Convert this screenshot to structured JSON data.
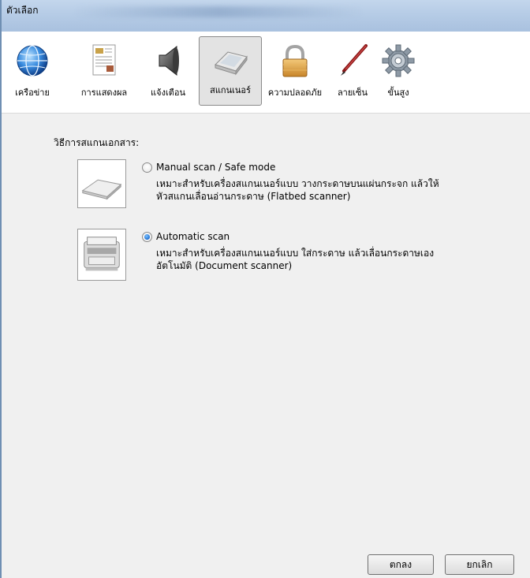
{
  "window": {
    "title": "ตัวเลือก"
  },
  "toolbar": {
    "items": [
      {
        "label": "เครือข่าย",
        "icon": "globe-icon"
      },
      {
        "label": "การแสดงผล",
        "icon": "document-icon"
      },
      {
        "label": "แจ้งเตือน",
        "icon": "speaker-icon"
      },
      {
        "label": "สแกนเนอร์",
        "icon": "scanner-icon",
        "selected": true
      },
      {
        "label": "ความปลอดภัย",
        "icon": "padlock-icon"
      },
      {
        "label": "ลายเซ็น",
        "icon": "pen-icon"
      },
      {
        "label": "ขั้นสูง",
        "icon": "gear-icon"
      }
    ]
  },
  "scan": {
    "heading": "วิธีการสแกนเอกสาร:",
    "options": [
      {
        "title": "Manual scan / Safe mode",
        "line1": "เหมาะสำหรับเครื่องสแกนเนอร์แบบ วางกระดาษบนแผ่นกระจก แล้วให้",
        "line2": "หัวสแกนเลื่อนอ่านกระดาษ (Flatbed scanner)",
        "checked": false,
        "icon": "flatbed-scanner-icon"
      },
      {
        "title": "Automatic scan",
        "line1": "เหมาะสำหรับเครื่องสแกนเนอร์แบบ ใส่กระดาษ แล้วเลื่อนกระดาษเอง",
        "line2": "อัตโนมัติ (Document scanner)",
        "checked": true,
        "icon": "document-scanner-icon"
      }
    ]
  },
  "buttons": {
    "ok": "ตกลง",
    "cancel": "ยกเลิก"
  },
  "colors": {
    "titlebar": "#b6cce6",
    "selected_radio": "#1f6fd1",
    "panel": "#f0f0f0"
  }
}
